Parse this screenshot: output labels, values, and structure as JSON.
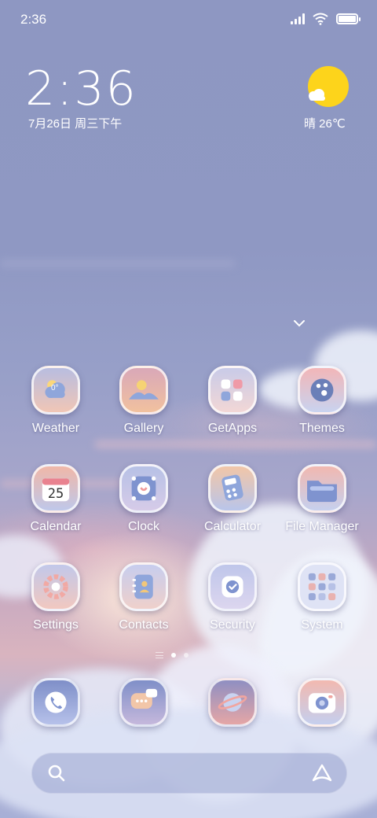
{
  "status_bar": {
    "time": "2:36"
  },
  "widget": {
    "time": "2:36",
    "date": "7月26日 周三下午",
    "weather": "晴 26℃"
  },
  "apps": [
    {
      "label": "Weather",
      "icon": "weather-icon",
      "badge": "0°"
    },
    {
      "label": "Gallery",
      "icon": "gallery-icon"
    },
    {
      "label": "GetApps",
      "icon": "getapps-icon"
    },
    {
      "label": "Themes",
      "icon": "themes-icon"
    },
    {
      "label": "Calendar",
      "icon": "calendar-icon",
      "badge": "25"
    },
    {
      "label": "Clock",
      "icon": "clock-icon"
    },
    {
      "label": "Calculator",
      "icon": "calculator-icon"
    },
    {
      "label": "File Manager",
      "icon": "folder-icon"
    },
    {
      "label": "Settings",
      "icon": "settings-icon"
    },
    {
      "label": "Contacts",
      "icon": "contacts-icon"
    },
    {
      "label": "Security",
      "icon": "security-icon"
    },
    {
      "label": "System",
      "icon": "system-folder-icon"
    }
  ],
  "dock": [
    {
      "icon": "phone-icon"
    },
    {
      "icon": "messages-icon"
    },
    {
      "icon": "browser-icon"
    },
    {
      "icon": "camera-icon"
    }
  ],
  "page_indicator": {
    "pages": 2,
    "current": 1
  },
  "colors": {
    "sun": "#fdd41b",
    "sky": "#8e97c2",
    "dusk_pink": "#d9b4bf"
  }
}
